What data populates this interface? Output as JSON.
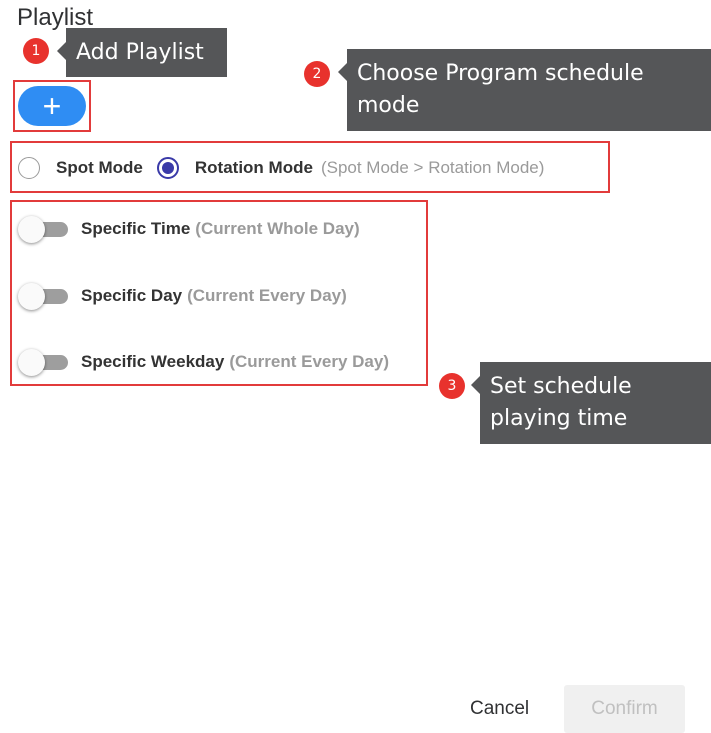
{
  "title": "Playlist",
  "callouts": [
    {
      "num": "1",
      "text": "Add Playlist"
    },
    {
      "num": "2",
      "text_line1": "Choose Program schedule",
      "text_line2": "mode"
    },
    {
      "num": "3",
      "text_line1": "Set schedule",
      "text_line2": "playing time"
    }
  ],
  "add_button": {
    "label": "+",
    "color": "#2f8df3"
  },
  "mode": {
    "options": [
      {
        "label": "Spot Mode",
        "checked": false
      },
      {
        "label": "Rotation Mode",
        "checked": true
      }
    ],
    "hint": "(Spot Mode > Rotation Mode)"
  },
  "schedule": [
    {
      "label": "Specific Time",
      "hint": "(Current Whole Day)",
      "on": false
    },
    {
      "label": "Specific Day",
      "hint": "(Current Every Day)",
      "on": false
    },
    {
      "label": "Specific Weekday",
      "hint": "(Current Every Day)",
      "on": false
    }
  ],
  "footer": {
    "cancel": "Cancel",
    "confirm": "Confirm"
  },
  "colors": {
    "highlight": "#e23b3b",
    "badge": "#e8322d",
    "tooltip": "#555658",
    "radio_checked": "#3a3aa8"
  }
}
